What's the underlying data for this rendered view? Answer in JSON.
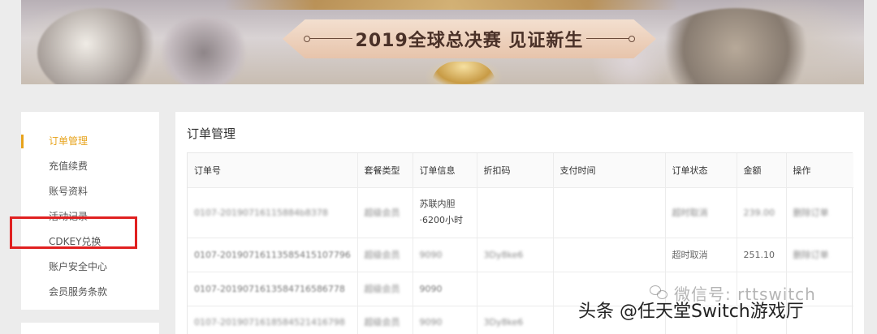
{
  "banner": {
    "title": "2019全球总决赛 见证新生"
  },
  "sidebar": {
    "items": [
      {
        "label": "订单管理",
        "active": true
      },
      {
        "label": "充值续费",
        "active": false
      },
      {
        "label": "账号资料",
        "active": false
      },
      {
        "label": "活动记录",
        "active": false
      },
      {
        "label": "CDKEY兑换",
        "active": false
      },
      {
        "label": "账户安全中心",
        "active": false
      },
      {
        "label": "会员服务条款",
        "active": false
      }
    ],
    "accent_color": "#e7a31b",
    "highlight_color": "#e02020"
  },
  "main": {
    "title": "订单管理",
    "columns": [
      "订单号",
      "套餐类型",
      "订单信息",
      "折扣码",
      "支付时间",
      "订单状态",
      "金额",
      "操作"
    ],
    "rows": [
      [
        "0107-20190716115884b8378",
        "超级会员",
        "苏联内胆·6200小时",
        "",
        "",
        "超时取消",
        "239.00",
        "删除订单"
      ],
      [
        "0107-20190716113585415107796",
        "超级会员",
        "9090",
        "3Dy8ke6",
        "",
        "超时取消",
        "251.10",
        "删除订单"
      ],
      [
        "0107-2019071613584716586778",
        "超级会员",
        "9090",
        "",
        "",
        "",
        "",
        ""
      ],
      [
        "0107-2019071618584521416798",
        "超级会员",
        "9090",
        "3Dy8ke6",
        "",
        "",
        "",
        ""
      ]
    ]
  },
  "watermarks": {
    "wechat": "微信号: rttswitch",
    "toutiao": "头条 @任天堂Switch游戏厅"
  }
}
